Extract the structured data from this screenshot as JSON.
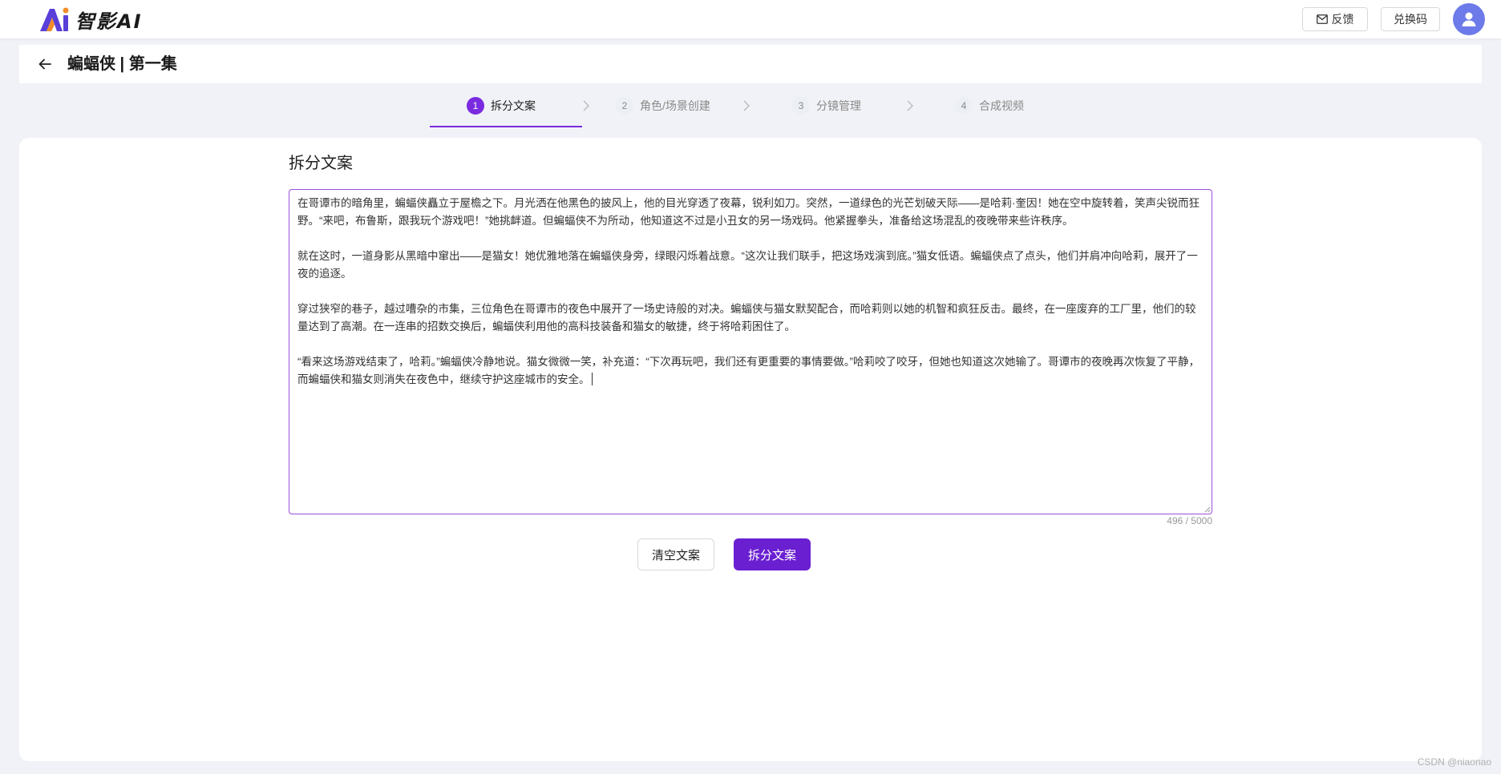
{
  "header": {
    "logo_text": "智影AI",
    "feedback_label": "反馈",
    "redeem_label": "兑换码"
  },
  "title_bar": {
    "title": "蝙蝠侠 | 第一集"
  },
  "steps": [
    {
      "number": "1",
      "label": "拆分文案",
      "active": true
    },
    {
      "number": "2",
      "label": "角色/场景创建",
      "active": false
    },
    {
      "number": "3",
      "label": "分镜管理",
      "active": false
    },
    {
      "number": "4",
      "label": "合成视频",
      "active": false
    }
  ],
  "editor": {
    "section_title": "拆分文案",
    "paragraphs": [
      "在哥谭市的暗角里，蝙蝠侠矗立于屋檐之下。月光洒在他黑色的披风上，他的目光穿透了夜幕，锐利如刀。突然，一道绿色的光芒划破天际——是哈莉·奎因！她在空中旋转着，笑声尖锐而狂野。“来吧，布鲁斯，跟我玩个游戏吧！”她挑衅道。但蝙蝠侠不为所动，他知道这不过是小丑女的另一场戏码。他紧握拳头，准备给这场混乱的夜晚带来些许秩序。",
      "就在这时，一道身影从黑暗中窜出——是猫女！她优雅地落在蝙蝠侠身旁，绿眼闪烁着战意。“这次让我们联手，把这场戏演到底。”猫女低语。蝙蝠侠点了点头，他们并肩冲向哈莉，展开了一夜的追逐。",
      "穿过狭窄的巷子，越过嘈杂的市集，三位角色在哥谭市的夜色中展开了一场史诗般的对决。蝙蝠侠与猫女默契配合，而哈莉则以她的机智和疯狂反击。最终，在一座废弃的工厂里，他们的较量达到了高潮。在一连串的招数交换后，蝙蝠侠利用他的高科技装备和猫女的敏捷，终于将哈莉困住了。",
      "“看来这场游戏结束了，哈莉。”蝙蝠侠冷静地说。猫女微微一笑，补充道：“下次再玩吧，我们还有更重要的事情要做。”哈莉咬了咬牙，但她也知道这次她输了。哥谭市的夜晚再次恢复了平静，而蝙蝠侠和猫女则消失在夜色中，继续守护这座城市的安全。"
    ],
    "char_count": "496 / 5000"
  },
  "actions": {
    "clear_label": "清空文案",
    "split_label": "拆分文案"
  },
  "watermark": "CSDN @niaonao",
  "colors": {
    "accent": "#6a1fd1",
    "step_active": "#7a2be0",
    "editor_border": "#9b4fd9",
    "avatar": "#6d7ae9",
    "page_bg": "#f1f2f7"
  },
  "icons": {
    "logo": "ai-logo-icon",
    "feedback": "mail-icon",
    "avatar": "user-icon",
    "back": "arrow-left-icon",
    "step_separator": "chevron-right-icon"
  }
}
